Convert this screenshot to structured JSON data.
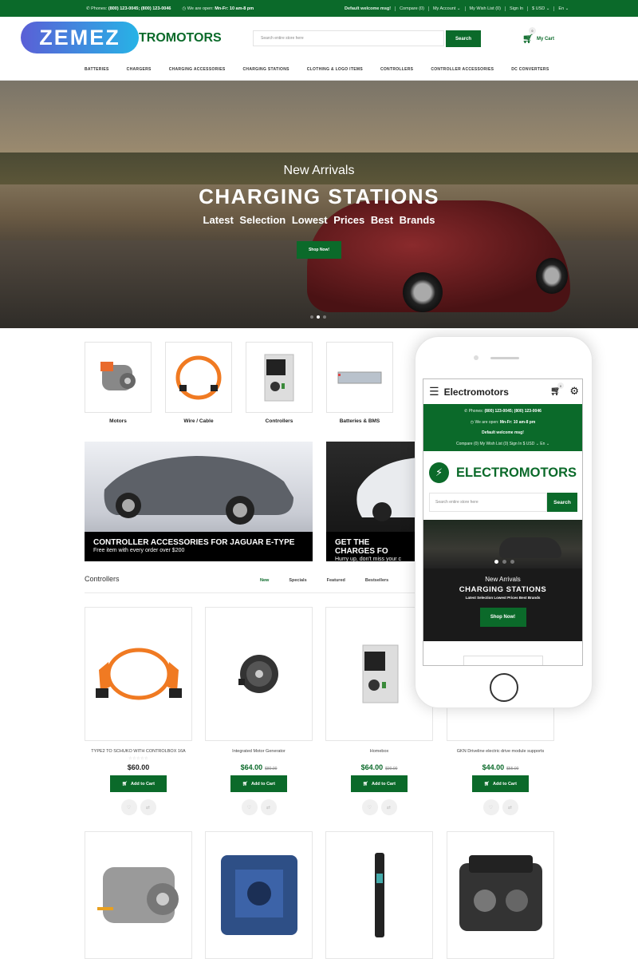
{
  "topbar": {
    "phones_label": "Phones:",
    "phones_value": "(800) 123-0045; (800) 123-0046",
    "hours_label": "We are open:",
    "hours_value": "Mn-Fr: 10 am-8 pm",
    "links": [
      "Default welcome msg!",
      "Compare (0)",
      "My Account ⌄",
      "My Wish List (0)",
      "Sign In",
      "$ USD ⌄",
      "En ⌄"
    ]
  },
  "header": {
    "watermark": "ZEMEZ",
    "logo_text": "TROMOTORS",
    "search_placeholder": "Search entire store here",
    "search_button": "Search",
    "cart_label": "My Cart",
    "cart_count": "0"
  },
  "nav": [
    "BATTERIES",
    "CHARGERS",
    "CHARGING ACCESSORIES",
    "CHARGING STATIONS",
    "CLOTHING & LOGO ITEMS",
    "CONTROLLERS",
    "CONTROLLER ACCESSORIES",
    "DC CONVERTERS"
  ],
  "hero": {
    "line1": "New Arrivals",
    "line2": "CHARGING STATIONS",
    "line3": "Latest Selection   Lowest Prices   Best Brands",
    "button": "Shop Now!",
    "slide_count": 3,
    "active_slide": 2
  },
  "categories": [
    {
      "label": "Motors",
      "icon": "motor-image"
    },
    {
      "label": "Wire / Cable",
      "icon": "cable-image"
    },
    {
      "label": "Controllers",
      "icon": "controller-image"
    },
    {
      "label": "Batteries & BMS",
      "icon": "battery-image"
    }
  ],
  "banners": [
    {
      "title": "CONTROLLER ACCESSORIES FOR JAGUAR E-TYPE",
      "subtitle": "Free item with every order over $200"
    },
    {
      "title": "GET THE CHARGES FO",
      "subtitle": "Hurry up, don't miss your c"
    }
  ],
  "section": {
    "title": "Controllers",
    "tabs": [
      "New",
      "Specials",
      "Featured",
      "Bestsellers"
    ],
    "active_tab": "New"
  },
  "products": [
    {
      "name": "TYPE2 TO SCHUKO WITH CONTROLBOX 16A",
      "rating": "☆☆☆☆☆",
      "price": "$60.00",
      "old_price": "",
      "button": "Add to Cart"
    },
    {
      "name": "Integrated Motor Generator",
      "rating": "",
      "price": "$64.00",
      "old_price": "$80.00",
      "button": "Add to Cart"
    },
    {
      "name": "Homebox",
      "rating": "",
      "price": "$64.00",
      "old_price": "$90.00",
      "button": "Add to Cart"
    },
    {
      "name": "GKN Driveline electric drive module supports",
      "rating": "",
      "price": "$44.00",
      "old_price": "$55.00",
      "button": "Add to Cart"
    }
  ],
  "mobile": {
    "app_title": "Electromotors",
    "cart_count": "0",
    "phones_label": "Phones:",
    "phones_value": "(800) 123-0045; (800) 123-0046",
    "hours_label": "We are open:",
    "hours_value": "Mn-Fr: 10 am-8 pm",
    "welcome": "Default welcome msg!",
    "links": "Compare (0)   My Wish List (0)   Sign In   $ USD ⌄   En ⌄",
    "logo_text": "ELECTROMOTORS",
    "search_placeholder": "Search entire store here",
    "search_button": "Search",
    "hero_line1": "New Arrivals",
    "hero_line2": "CHARGING STATIONS",
    "hero_line3": "Latest Selection  Lowest Prices  Best Brands",
    "hero_button": "Shop Now!"
  },
  "colors": {
    "brand_green": "#0b6a2a"
  }
}
